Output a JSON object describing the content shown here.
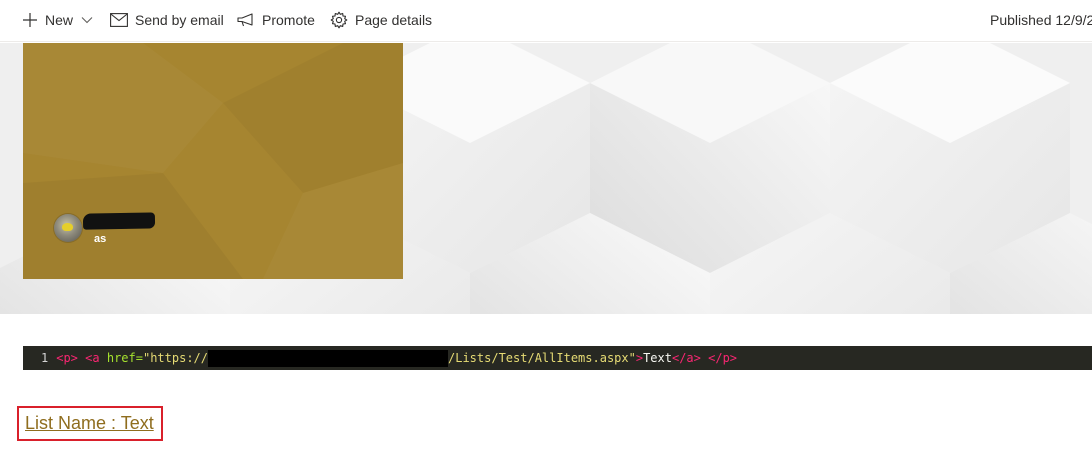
{
  "command_bar": {
    "new_label": "New",
    "send_email_label": "Send by email",
    "promote_label": "Promote",
    "page_details_label": "Page details",
    "published_text": "Published 12/9/2"
  },
  "hero": {
    "tile_color": "#a68530",
    "author_suffix": "as"
  },
  "code": {
    "line_number": "1",
    "open_p": "<p>",
    "open_a": "<a",
    "href_attr": "href=",
    "href_start": "\"https://",
    "href_end": "/Lists/Test/AllItems.aspx\"",
    "close_bracket": ">",
    "link_text": "Text",
    "close_a": "</a>",
    "close_p": "</p>"
  },
  "link": {
    "label": "List Name : Text",
    "highlight_color": "#d9202b"
  },
  "icons": [
    "plus-icon",
    "chevron-down-icon",
    "mail-icon",
    "megaphone-icon",
    "gear-icon"
  ]
}
